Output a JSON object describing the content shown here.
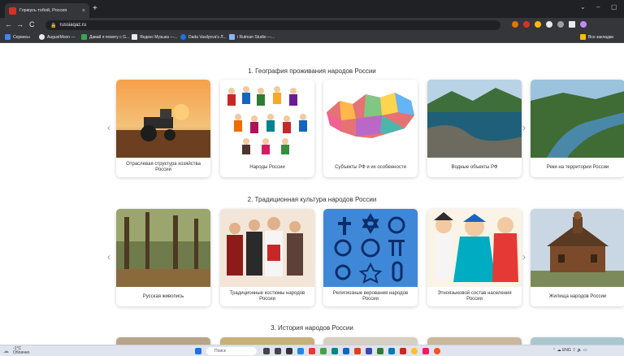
{
  "browser": {
    "tab_title": "Горжусь тобой, Россия",
    "tab_close": "×",
    "new_tab": "+",
    "url": "russiaqaz.ru",
    "back": "←",
    "forward": "→",
    "reload": "C",
    "lock": "🔒",
    "minimize": "–",
    "maximize": "▢",
    "bookmarks": [
      "Сервисы",
      "AugustMoon —",
      "Давай я помогу с G...",
      "Яндекс Музыка —...",
      "Dada Vasilyeva's Л...",
      "i Rutman Studio —..."
    ],
    "all_bookmarks": "Все закладки"
  },
  "sections": [
    {
      "title": "1. География проживания народов России",
      "cards": [
        {
          "label": "Отраслевая структура хозяйства России",
          "image": "tractor-field"
        },
        {
          "label": "Народы России",
          "image": "peoples-costumes"
        },
        {
          "label": "Субъекты РФ и их особенности",
          "image": "regions-map"
        },
        {
          "label": "Водные объекты РФ",
          "image": "lake-landscape"
        },
        {
          "label": "Реки на территории России",
          "image": "river-landscape"
        }
      ]
    },
    {
      "title": "2. Традиционная культура народов России",
      "cards": [
        {
          "label": "Русская живопись",
          "image": "painting-forest"
        },
        {
          "label": "Традиционные костюмы народов России",
          "image": "traditional-costumes"
        },
        {
          "label": "Религиозные верования народов России",
          "image": "religion-symbols"
        },
        {
          "label": "Этноязыковой состав населения России",
          "image": "ethnic-illustration"
        },
        {
          "label": "Жилища народов России",
          "image": "wooden-church"
        }
      ]
    },
    {
      "title": "3. История народов России",
      "cards": []
    }
  ],
  "taskbar": {
    "weather_temp": "-1°C",
    "weather_desc": "Облачно",
    "search": "Поиск",
    "lang": "ENG"
  },
  "colors": {
    "titlebar": "#202124",
    "toolbar": "#35363a",
    "accent_red": "#d93025"
  }
}
